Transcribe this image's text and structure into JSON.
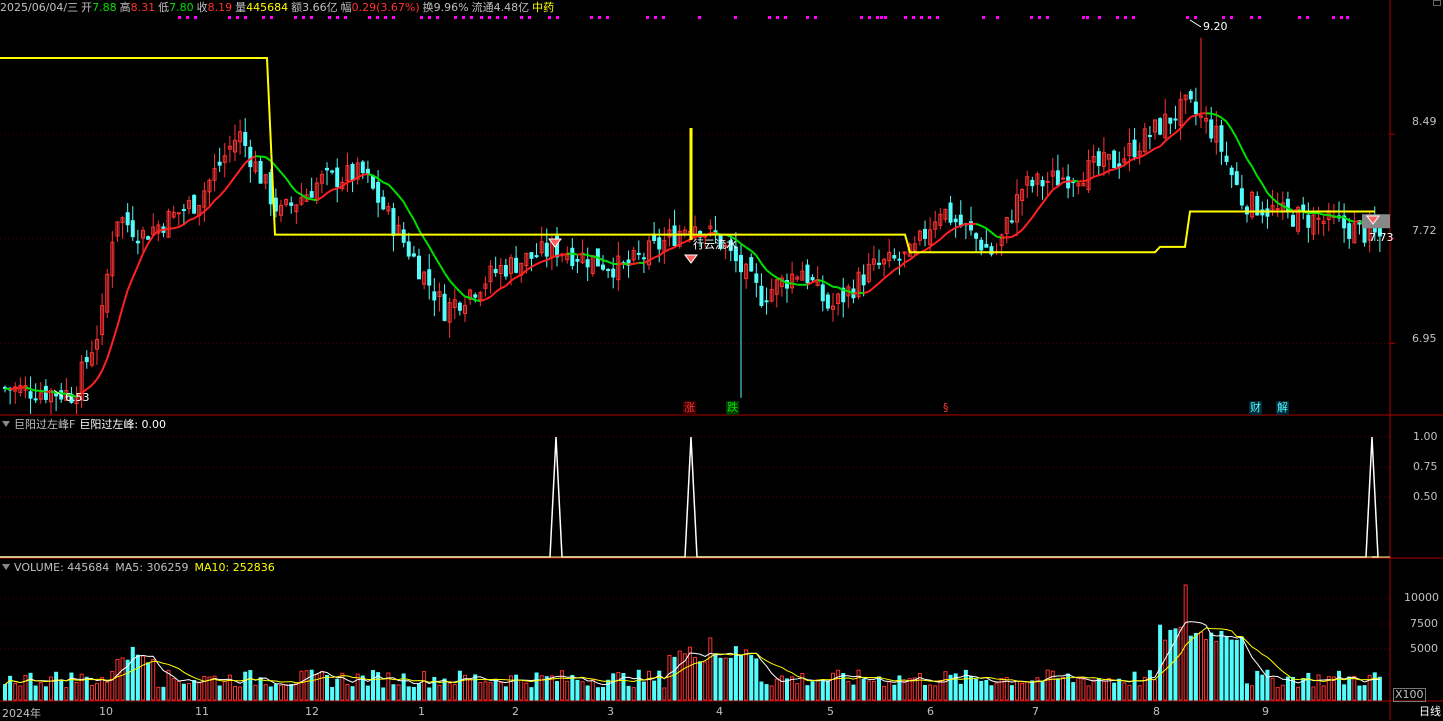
{
  "header": {
    "date": "2025/06/04/三",
    "open_label": "开",
    "open": "7.88",
    "high_label": "高",
    "high": "8.31",
    "low_label": "低",
    "low": "7.80",
    "close_label": "收",
    "close": "8.19",
    "vol_label": "量",
    "vol": "445684",
    "amount_label": "额",
    "amount": "3.66亿",
    "change_label": "幅",
    "change": "0.29(3.67%)",
    "turnover_label": "换",
    "turnover": "9.96%",
    "float_label": "流通",
    "float": "4.48亿",
    "sector": "中药"
  },
  "price_axis": {
    "labels": [
      "8.49",
      "7.72",
      "6.95"
    ],
    "current": "7.73"
  },
  "annotations": {
    "high": "9.20",
    "low": "6.53",
    "signal_text": "行云流水"
  },
  "events": [
    "涨",
    "跌",
    "§",
    "财",
    "解"
  ],
  "indicator": {
    "name": "巨阳过左峰F",
    "value_label": "巨阳过左峰: 0.00",
    "axis": [
      "1.00",
      "0.75",
      "0.50"
    ]
  },
  "volume": {
    "label": "VOLUME: 445684",
    "ma5": "MA5: 306259",
    "ma10": "MA10: 252836",
    "axis": [
      "10000",
      "7500",
      "5000"
    ],
    "unit": "X100"
  },
  "x_axis": [
    "2024年",
    "10",
    "11",
    "12",
    "1",
    "2",
    "3",
    "4",
    "5",
    "6",
    "7",
    "8",
    "9"
  ],
  "period": "日线",
  "colors": {
    "up": "#ff3232",
    "down": "#54fcfc",
    "ma_up": "#ff2020",
    "ma_down": "#00e000",
    "line_yellow": "#ffff00",
    "signal_magenta": "#ff00ff"
  },
  "chart_data": {
    "type": "candlestick",
    "price_range": [
      6.43,
      9.3
    ],
    "key_prices": {
      "high": 9.2,
      "low": 6.53,
      "last": 7.73
    },
    "indicator_spikes": [
      1.0,
      1.0,
      1.0
    ],
    "volume_peak": 11500
  }
}
